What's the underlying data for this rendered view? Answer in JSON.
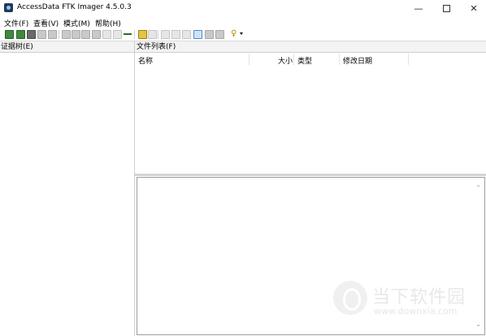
{
  "window": {
    "title": "AccessData FTK Imager 4.5.0.3",
    "controls": {
      "minimize": "—",
      "maximize": "",
      "close": "✕"
    }
  },
  "menu": [
    "文件(F)",
    "查看(V)",
    "模式(M)",
    "帮助(H)"
  ],
  "toolbar": {
    "icons": [
      "add-evidence-icon",
      "add-all-evidence-icon",
      "image-mounting-icon",
      "remove-evidence-icon",
      "remove-all-icon",
      "create-disk-image-icon",
      "export-disk-image-icon",
      "export-logical-image-icon",
      "capture-memory-icon",
      "obtain-protected-files-icon",
      "detect-efs-icon",
      "export-files-icon",
      "export-hash-list-icon",
      "verify-drive-icon",
      "view-files-icon",
      "view-text-icon",
      "view-hex-icon",
      "auto-view-icon",
      "text-view-icon",
      "hex-view-icon",
      "help-icon"
    ]
  },
  "left_panel": {
    "header": "证据树(E)"
  },
  "file_list": {
    "header": "文件列表(F)",
    "columns": {
      "name": "名称",
      "size": "大小",
      "type": "类型",
      "modified": "修改日期"
    }
  },
  "watermark": {
    "big": "当下软件园",
    "small": "www.downxia.com"
  }
}
